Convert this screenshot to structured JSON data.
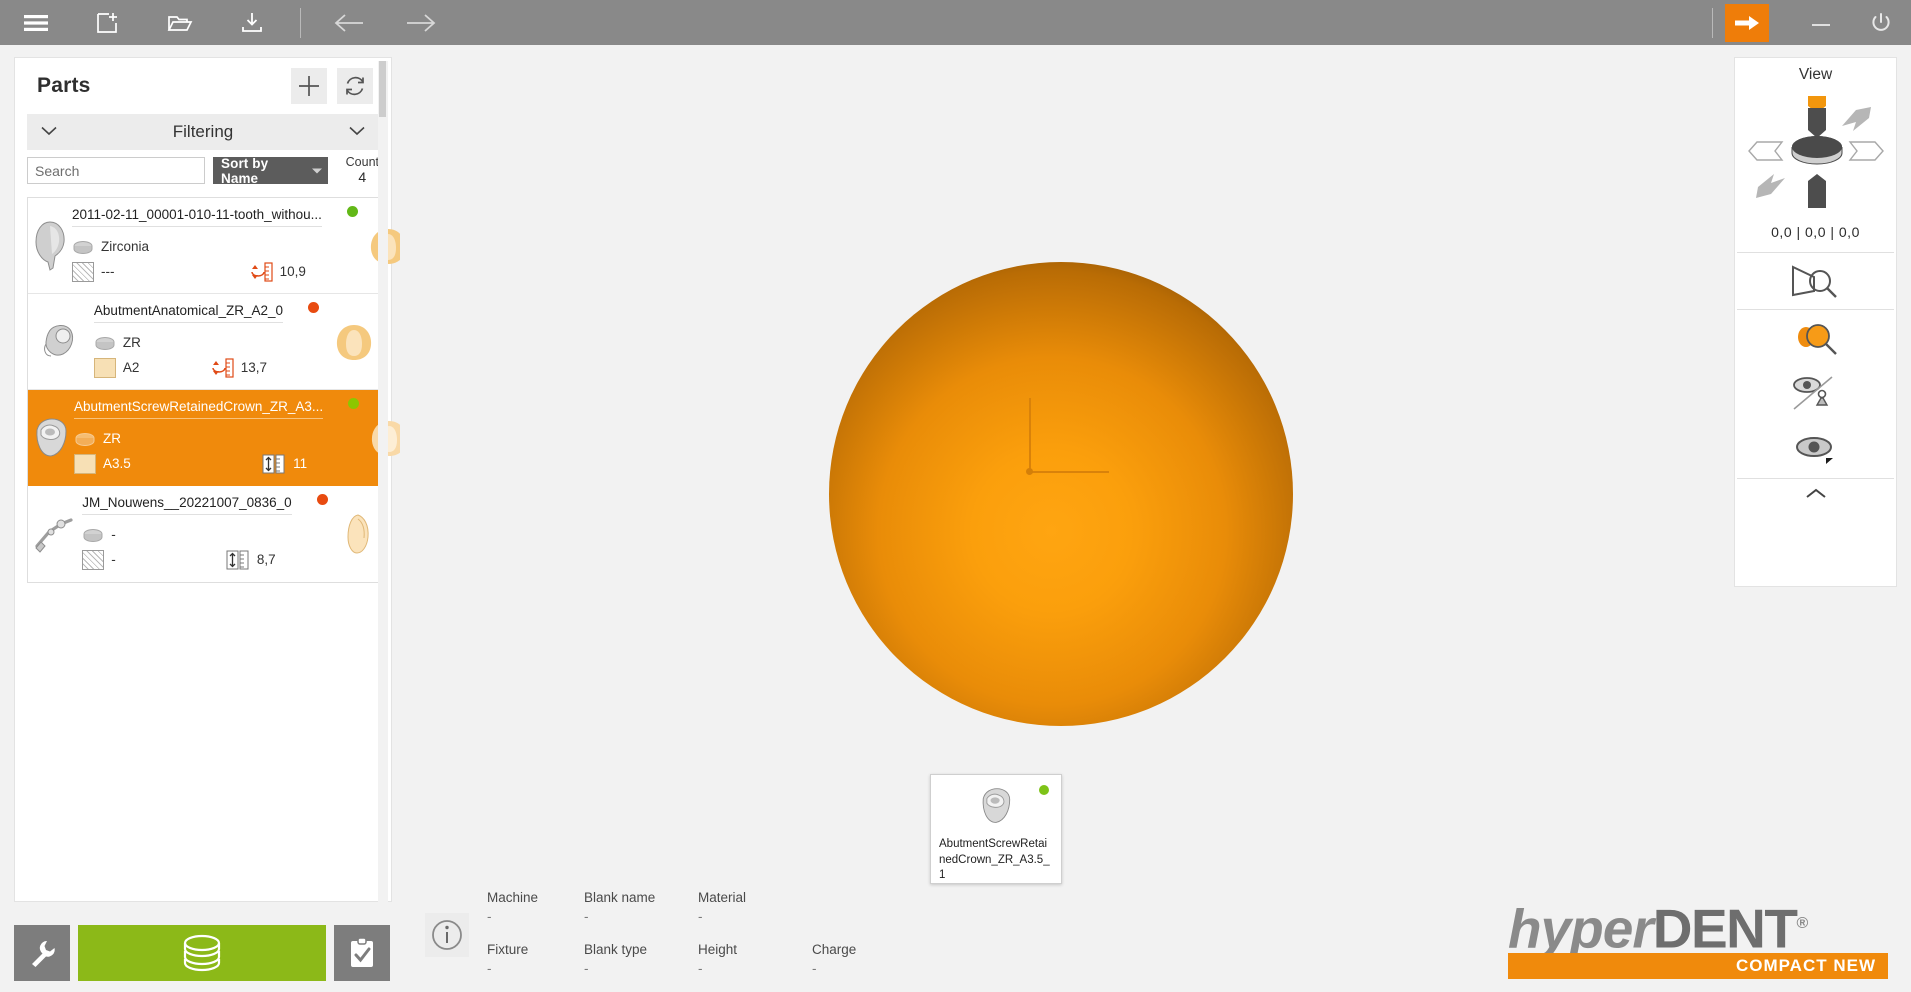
{
  "topbar": {
    "menu_label": "hamburger-menu",
    "buttons": [
      {
        "name": "menu",
        "icon": "hamburger-icon"
      },
      {
        "name": "new-project",
        "icon": "new-document-icon"
      },
      {
        "name": "open-project",
        "icon": "folder-open-icon"
      },
      {
        "name": "import",
        "icon": "download-icon"
      },
      {
        "name": "back",
        "icon": "arrow-left-icon"
      },
      {
        "name": "forward",
        "icon": "arrow-right-icon"
      }
    ],
    "next_label": "next-step-arrow",
    "minimize_label": "minimize",
    "power_label": "power"
  },
  "parts": {
    "title": "Parts",
    "add_label": "+",
    "refresh_label": "refresh",
    "filtering_label": "Filtering",
    "search": {
      "value": "",
      "placeholder": "Search"
    },
    "sort": {
      "label": "Sort by Name"
    },
    "count": {
      "label": "Count",
      "value": "4"
    },
    "items": [
      {
        "name": "2011-02-11_00001-010-11-tooth_withou...",
        "status_color": "#62b817",
        "material": "Zirconia",
        "shade": "---",
        "shade_type": "hatch",
        "measure": "10,9",
        "measure_icon": "rotation-height-icon",
        "selected": false
      },
      {
        "name": "AbutmentAnatomical_ZR_A2_0",
        "status_color": "#e84b10",
        "material": "ZR",
        "shade": "A2",
        "shade_type": "solid",
        "measure": "13,7",
        "measure_icon": "rotation-height-icon",
        "selected": false
      },
      {
        "name": "AbutmentScrewRetainedCrown_ZR_A3...",
        "status_color": "#8cc700",
        "material": "ZR",
        "shade": "A3.5",
        "shade_type": "solid",
        "measure": "11",
        "measure_icon": "height-icon",
        "selected": true
      },
      {
        "name": "JM_Nouwens__20221007_0836_0",
        "status_color": "#e84b10",
        "material": "-",
        "shade": "-",
        "shade_type": "hatch",
        "measure": "8,7",
        "measure_icon": "height-icon",
        "selected": false
      }
    ]
  },
  "bottom_buttons": [
    {
      "name": "tools-button",
      "icon": "wrench-icon"
    },
    {
      "name": "blank-button",
      "icon": "blank-disc-icon",
      "color": "#8cb918"
    },
    {
      "name": "checklist-button",
      "icon": "clipboard-check-icon"
    }
  ],
  "viewport": {
    "blank_label": "blank-sphere",
    "card": {
      "title": "AbutmentScrewRetainedCrown_ZR_A3.5_1",
      "status_color": "#7ec318"
    }
  },
  "view_panel": {
    "title": "View",
    "coordinates": "0,0  |  0,0 |  0,0",
    "tools": [
      {
        "name": "zoom-to-fit-icon"
      },
      {
        "name": "zoom-selection-icon"
      },
      {
        "name": "hide-object-icon"
      },
      {
        "name": "show-all-icon"
      }
    ],
    "collapse_label": "collapse"
  },
  "status": {
    "info_label": "i",
    "fields": [
      {
        "label": "Machine",
        "value": "-"
      },
      {
        "label": "Blank name",
        "value": "-"
      },
      {
        "label": "Material",
        "value": "-"
      },
      {
        "label": "Fixture",
        "value": "-"
      },
      {
        "label": "Blank type",
        "value": "-"
      },
      {
        "label": "Height",
        "value": "-"
      },
      {
        "label": "Charge",
        "value": "-"
      }
    ]
  },
  "logo": {
    "part1": "hyper",
    "part2": "DENT",
    "registered": "®",
    "subtitle": "COMPACT NEW",
    "accent": "#f08a0c"
  }
}
